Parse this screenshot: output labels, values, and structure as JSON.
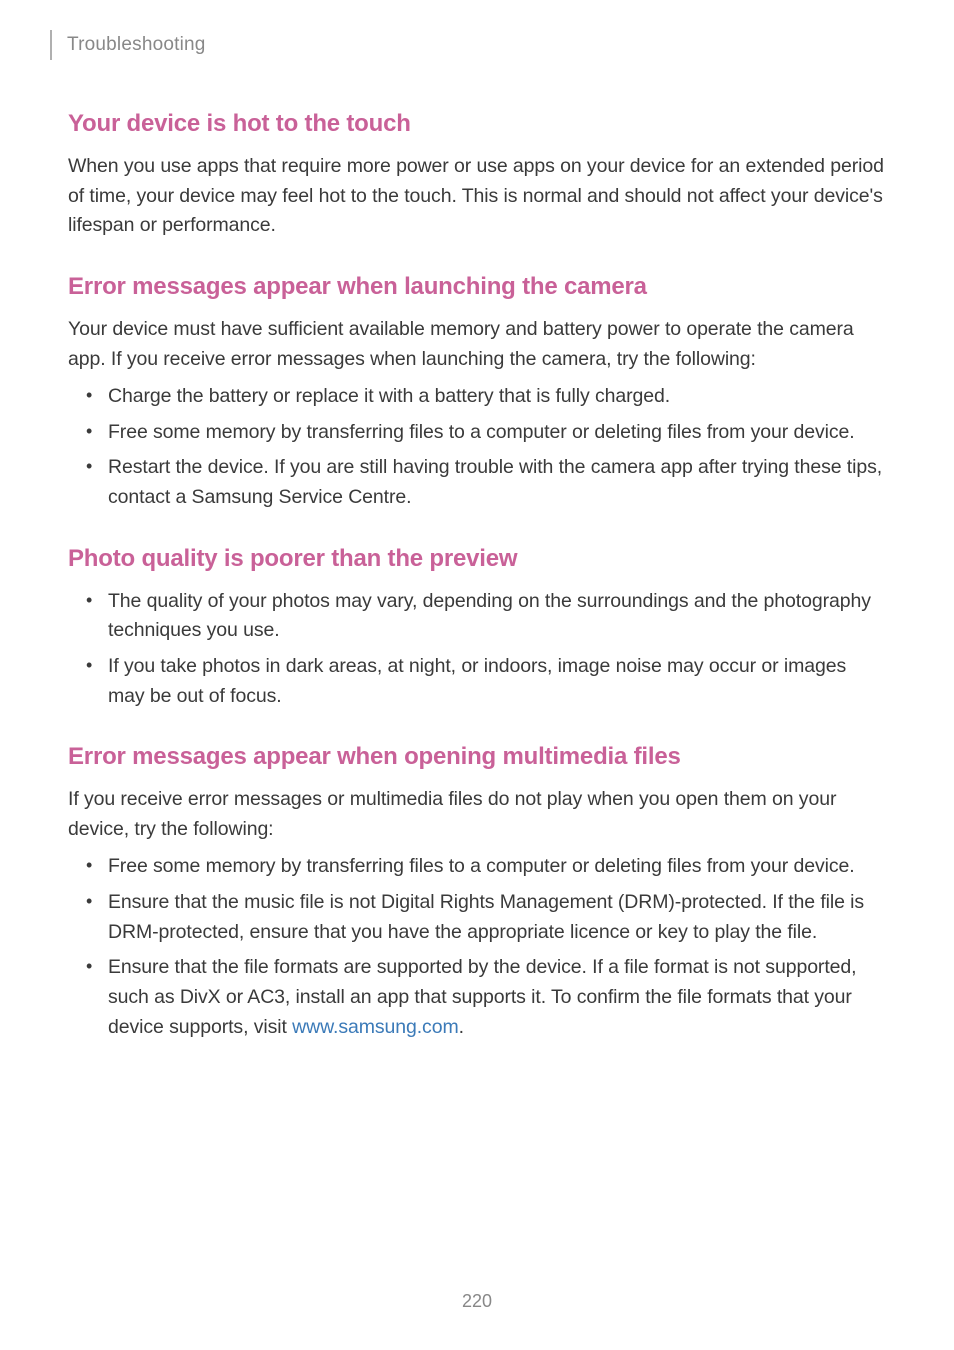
{
  "header": {
    "breadcrumb": "Troubleshooting"
  },
  "sections": [
    {
      "heading": "Your device is hot to the touch",
      "body": "When you use apps that require more power or use apps on your device for an extended period of time, your device may feel hot to the touch. This is normal and should not affect your device's lifespan or performance."
    },
    {
      "heading": "Error messages appear when launching the camera",
      "body": "Your device must have sufficient available memory and battery power to operate the camera app. If you receive error messages when launching the camera, try the following:",
      "bullets": [
        "Charge the battery or replace it with a battery that is fully charged.",
        "Free some memory by transferring files to a computer or deleting files from your device.",
        "Restart the device. If you are still having trouble with the camera app after trying these tips, contact a Samsung Service Centre."
      ]
    },
    {
      "heading": "Photo quality is poorer than the preview",
      "bullets": [
        "The quality of your photos may vary, depending on the surroundings and the photography techniques you use.",
        "If you take photos in dark areas, at night, or indoors, image noise may occur or images may be out of focus."
      ]
    },
    {
      "heading": "Error messages appear when opening multimedia files",
      "body": "If you receive error messages or multimedia files do not play when you open them on your device, try the following:",
      "bullets": [
        "Free some memory by transferring files to a computer or deleting files from your device.",
        "Ensure that the music file is not Digital Rights Management (DRM)-protected. If the file is DRM-protected, ensure that you have the appropriate licence or key to play the file."
      ],
      "lastBullet": {
        "prefix": "Ensure that the file formats are supported by the device. If a file format is not supported, such as DivX or AC3, install an app that supports it. To confirm the file formats that your device supports, visit ",
        "link": "www.samsung.com",
        "suffix": "."
      }
    }
  ],
  "pageNumber": "220"
}
